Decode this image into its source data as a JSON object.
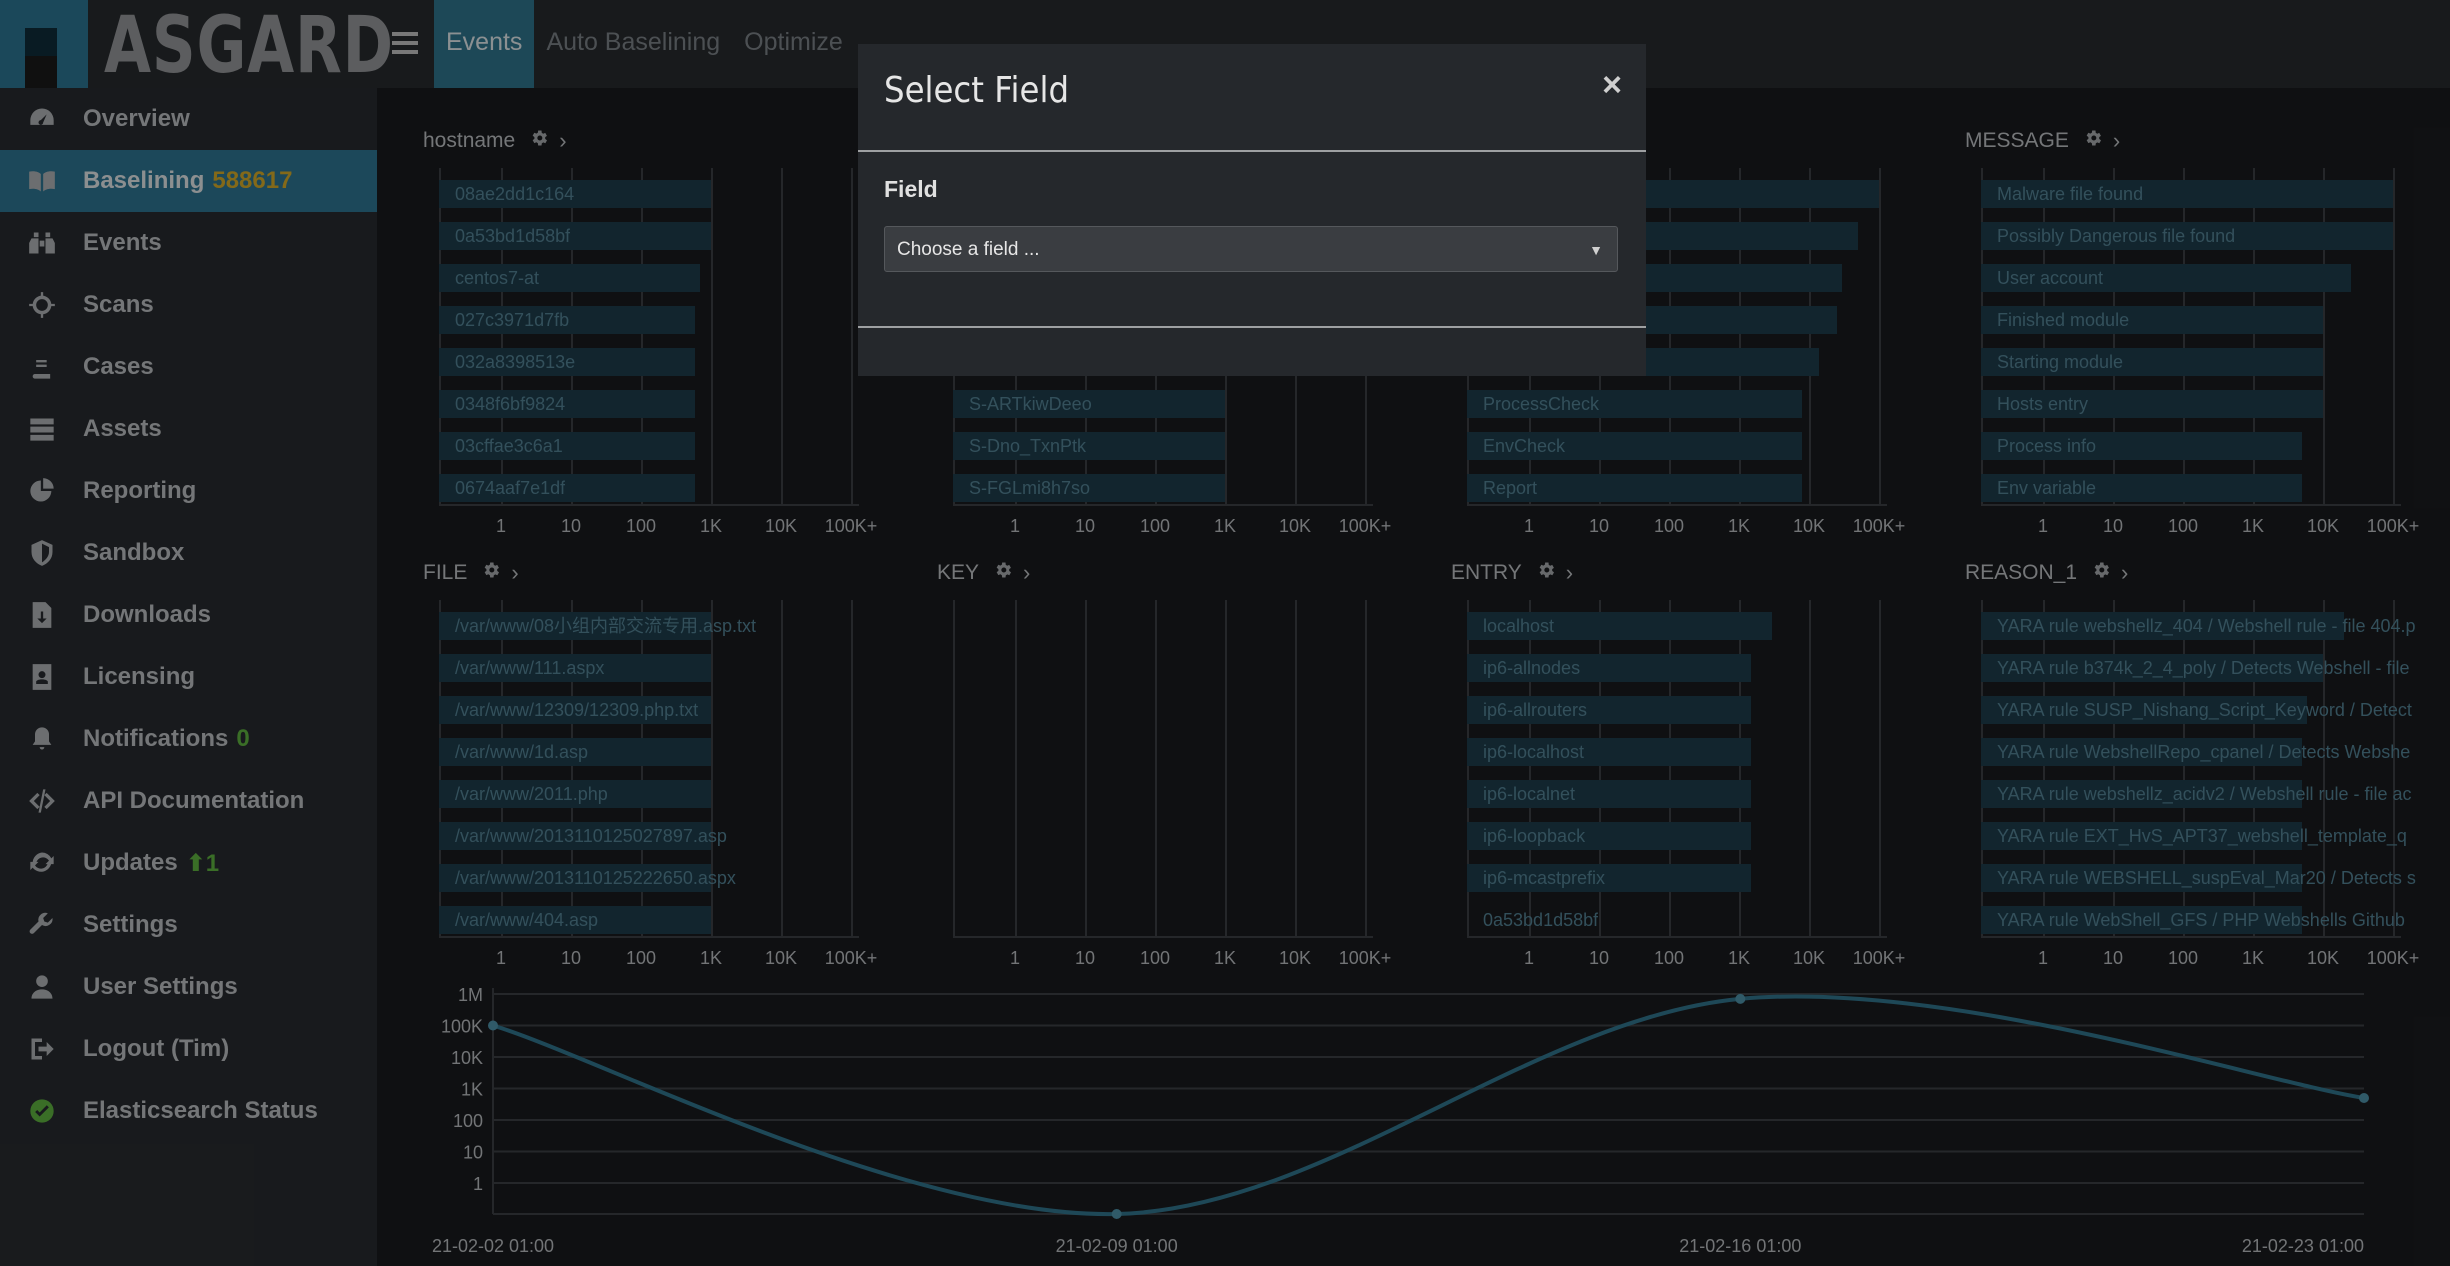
{
  "app": {
    "brand": "ASGARD"
  },
  "topnav": [
    {
      "label": "Events",
      "active": true
    },
    {
      "label": "Auto Baselining"
    },
    {
      "label": "Optimize"
    }
  ],
  "sidebar": [
    {
      "label": "Overview",
      "icon": "dashboard-icon"
    },
    {
      "label": "Baselining",
      "badge": "588617",
      "icon": "book-open-icon",
      "active": true
    },
    {
      "label": "Events",
      "icon": "binoculars-icon"
    },
    {
      "label": "Scans",
      "icon": "crosshairs-icon"
    },
    {
      "label": "Cases",
      "icon": "book-icon"
    },
    {
      "label": "Assets",
      "icon": "server-icon"
    },
    {
      "label": "Reporting",
      "icon": "pie-chart-icon"
    },
    {
      "label": "Sandbox",
      "icon": "shield-icon"
    },
    {
      "label": "Downloads",
      "icon": "file-download-icon"
    },
    {
      "label": "Licensing",
      "icon": "id-badge-icon"
    },
    {
      "label": "Notifications",
      "badge": "0",
      "icon": "bell-icon"
    },
    {
      "label": "API Documentation",
      "icon": "code-icon"
    },
    {
      "label": "Updates",
      "badge": "1",
      "icon": "sync-icon"
    },
    {
      "label": "Settings",
      "icon": "wrench-icon"
    },
    {
      "label": "User Settings",
      "icon": "user-icon"
    },
    {
      "label": "Logout (Tim)",
      "icon": "sign-out-icon"
    },
    {
      "label": "Elasticsearch Status",
      "icon": "check-circle-icon"
    }
  ],
  "colors": {
    "accent": "#2c6f8b",
    "badge_yellow": "#c9a227",
    "badge_green": "#5aaa3c",
    "bar": "#1d3a48",
    "line": "#2f6f86"
  },
  "ticks": [
    "1",
    "10",
    "100",
    "1K",
    "10K",
    "100K+"
  ],
  "panels": [
    {
      "title": "hostname",
      "labels": [
        "08ae2dd1c164",
        "0a53bd1d58bf",
        "centos7-at",
        "027c3971d7fb",
        "032a8398513e",
        "0348f6bf9824",
        "03cffae3c6a1",
        "0674aaf7e1df"
      ],
      "values": [
        1000,
        1000,
        700,
        600,
        600,
        600,
        600,
        600
      ]
    },
    {
      "title": "",
      "labels": [
        "",
        "",
        "",
        "",
        "",
        "S-ARTkiwDeeo",
        "S-Dno_TxnPtk",
        "S-FGLmi8h7so"
      ],
      "values": [
        1000,
        1000,
        1000,
        1000,
        1000,
        1000,
        1000,
        1000
      ]
    },
    {
      "title": "",
      "labels": [
        "",
        "",
        "",
        "",
        "",
        "ProcessCheck",
        "EnvCheck",
        "Report"
      ],
      "values": [
        100000,
        50000,
        30000,
        25000,
        14000,
        8000,
        8000,
        8000
      ]
    },
    {
      "title": "MESSAGE",
      "labels": [
        "Malware file found",
        "Possibly Dangerous file found",
        "User account",
        "Finished module",
        "Starting module",
        "Hosts entry",
        "Process info",
        "Env variable"
      ],
      "values": [
        100000,
        100000,
        25000,
        10000,
        10000,
        10000,
        5000,
        5000
      ]
    },
    {
      "title": "FILE",
      "labels": [
        "/var/www/08小组内部交流专用.asp.txt",
        "/var/www/111.aspx",
        "/var/www/12309/12309.php.txt",
        "/var/www/1d.asp",
        "/var/www/2011.php",
        "/var/www/2013110125027897.asp",
        "/var/www/2013110125222650.aspx",
        "/var/www/404.asp"
      ],
      "values": [
        1000,
        1000,
        1000,
        1000,
        1000,
        1000,
        1000,
        1000
      ]
    },
    {
      "title": "KEY",
      "labels": [],
      "values": []
    },
    {
      "title": "ENTRY",
      "labels": [
        "localhost",
        "ip6-allnodes",
        "ip6-allrouters",
        "ip6-localhost",
        "ip6-localnet",
        "ip6-loopback",
        "ip6-mcastprefix",
        "0a53bd1d58bf"
      ],
      "values": [
        3000,
        1500,
        1500,
        1500,
        1500,
        1500,
        1500,
        1
      ]
    },
    {
      "title": "REASON_1",
      "labels": [
        "YARA rule webshellz_404 / Webshell rule - file 404.p",
        "YARA rule b374k_2_4_poly / Detects Webshell - file",
        "YARA rule SUSP_Nishang_Script_Keyword / Detect",
        "YARA rule WebshellRepo_cpanel / Detects Webshe",
        "YARA rule webshellz_acidv2 / Webshell rule - file ac",
        "YARA rule EXT_HvS_APT37_webshell_template_q",
        "YARA rule WEBSHELL_suspEval_Mar20 / Detects s",
        "YARA rule WebShell_GFS / PHP Webshells Github"
      ],
      "values": [
        20000,
        10000,
        6000,
        5000,
        5000,
        5000,
        5000,
        5000
      ]
    }
  ],
  "timeline": {
    "y_ticks": [
      "1M",
      "100K",
      "10K",
      "1K",
      "100",
      "10",
      "1"
    ],
    "x_ticks": [
      "21-02-02 01:00",
      "21-02-09 01:00",
      "21-02-16 01:00",
      "21-02-23 01:00"
    ],
    "points": [
      {
        "x": "21-02-02 01:00",
        "y": 100000
      },
      {
        "x": "21-02-09 01:00",
        "y": 0
      },
      {
        "x": "21-02-16 01:00",
        "y": 700000
      },
      {
        "x": "21-02-23 01:00",
        "y": 500
      }
    ]
  },
  "modal": {
    "title": "Select Field",
    "close": "×",
    "field_label": "Field",
    "select_value": "Choose a field ..."
  }
}
